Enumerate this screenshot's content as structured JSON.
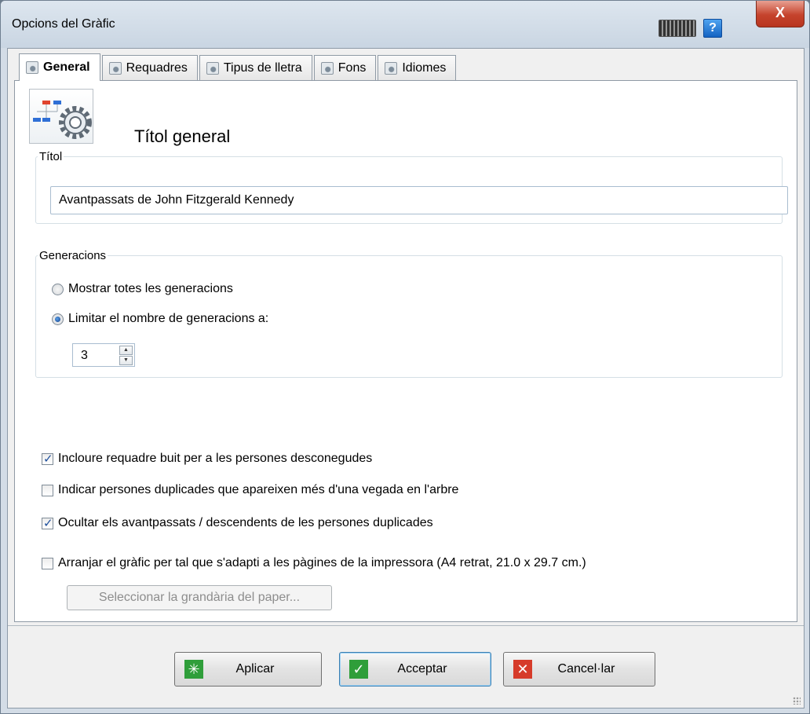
{
  "window": {
    "title": "Opcions del Gràfic",
    "help_label": "?",
    "close_label": "X"
  },
  "tabs": [
    {
      "label": "General",
      "active": true
    },
    {
      "label": "Requadres",
      "active": false
    },
    {
      "label": "Tipus de lletra",
      "active": false
    },
    {
      "label": "Fons",
      "active": false
    },
    {
      "label": "Idiomes",
      "active": false
    }
  ],
  "general": {
    "heading": "Títol general",
    "title_group": {
      "legend": "Títol",
      "value": "Avantpassats de John Fitzgerald Kennedy"
    },
    "generations_group": {
      "legend": "Generacions",
      "option_all": "Mostrar totes les generacions",
      "option_limit": "Limitar el nombre de generacions a:",
      "selected": "limit",
      "limit_value": "3"
    },
    "checkboxes": [
      {
        "label": "Incloure requadre buit per a les persones desconegudes",
        "checked": true
      },
      {
        "label": "Indicar persones duplicades que apareixen més d'una vegada en l'arbre",
        "checked": false
      },
      {
        "label": "Ocultar els avantpassats / descendents de les persones duplicades",
        "checked": true
      },
      {
        "label": "Arranjar el gràfic per tal que s'adapti a les pàgines de la impressora (A4 retrat, 21.0 x 29.7 cm.)",
        "checked": false
      }
    ],
    "paper_size_button": "Seleccionar la grandària del paper..."
  },
  "buttons": {
    "apply": "Aplicar",
    "ok": "Acceptar",
    "cancel": "Cancel·lar"
  },
  "colors": {
    "apply_icon": "#2f9e3a",
    "ok_icon": "#2f9e3a",
    "cancel_icon": "#d63b2a"
  },
  "icons": {
    "tab": "settings-page-icon",
    "header": "chart-settings-icon",
    "apply": "sparkle-icon",
    "ok": "checkmark-icon",
    "cancel": "x-icon"
  }
}
